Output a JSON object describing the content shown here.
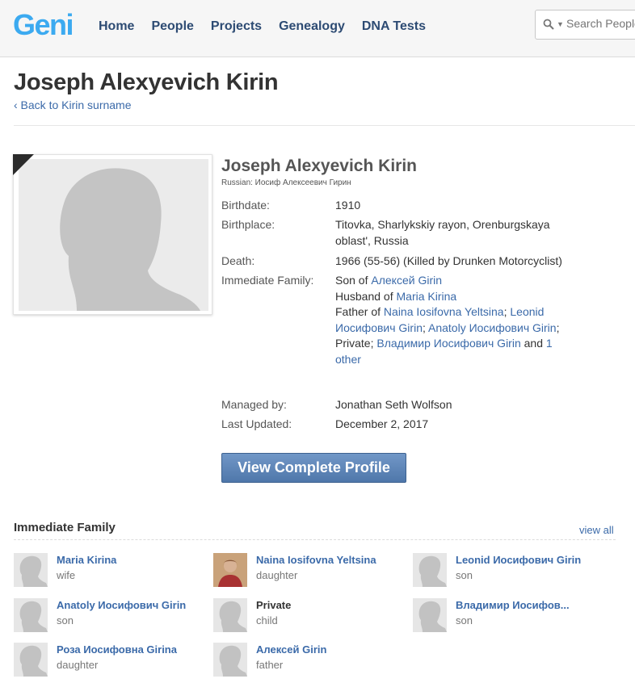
{
  "header": {
    "logo": "Geni",
    "nav": [
      "Home",
      "People",
      "Projects",
      "Genealogy",
      "DNA Tests"
    ],
    "search_placeholder": "Search People"
  },
  "page": {
    "title": "Joseph Alexyevich Kirin",
    "back_link": "‹ Back to Kirin surname"
  },
  "profile": {
    "name": "Joseph Alexyevich Kirin",
    "native_name": "Russian: Иосиф Алексеевич Гирин",
    "birthdate_label": "Birthdate:",
    "birthdate": "1910",
    "birthplace_label": "Birthplace:",
    "birthplace_line1": "Titovka, Sharlykskiy rayon, Orenburgskaya",
    "birthplace_line2": "oblast', Russia",
    "death_label": "Death:",
    "death": "1966 (55-56) (Killed by Drunken Motorcyclist)",
    "family_label": "Immediate Family:",
    "son_of_prefix": "Son of ",
    "son_of": "Алексей Girin",
    "husband_of_prefix": "Husband of ",
    "husband_of": "Maria Kirina",
    "father_of_prefix": "Father of ",
    "child1": "Naina Iosifovna Yeltsina",
    "child2_a": "Leonid",
    "child2_b": "Иосифович Girin",
    "child3": "Anatoly Иосифович Girin",
    "private": "Private",
    "child5": "Владимир Иосифович Girin",
    "and_text": " and ",
    "other_a": "1",
    "other_b": "other",
    "managed_label": "Managed by:",
    "managed_by": "Jonathan Seth Wolfson",
    "updated_label": "Last Updated:",
    "updated": "December 2, 2017",
    "view_button": "View Complete Profile"
  },
  "family": {
    "title": "Immediate Family",
    "view_all": "view all",
    "members": [
      {
        "name": "Maria Kirina",
        "relation": "wife",
        "photo": false,
        "linked": true
      },
      {
        "name": "Naina Iosifovna Yeltsina",
        "relation": "daughter",
        "photo": true,
        "linked": true
      },
      {
        "name": "Leonid Иосифович Girin",
        "relation": "son",
        "photo": false,
        "linked": true
      },
      {
        "name": "Anatoly Иосифович Girin",
        "relation": "son",
        "photo": false,
        "linked": true
      },
      {
        "name": "Private",
        "relation": "child",
        "photo": false,
        "linked": false
      },
      {
        "name": "Владимир Иосифов...",
        "relation": "son",
        "photo": false,
        "linked": true
      },
      {
        "name": "Роза Иосифовна Girina",
        "relation": "daughter",
        "photo": false,
        "linked": true
      },
      {
        "name": "Алексей Girin",
        "relation": "father",
        "photo": false,
        "linked": true
      }
    ]
  }
}
